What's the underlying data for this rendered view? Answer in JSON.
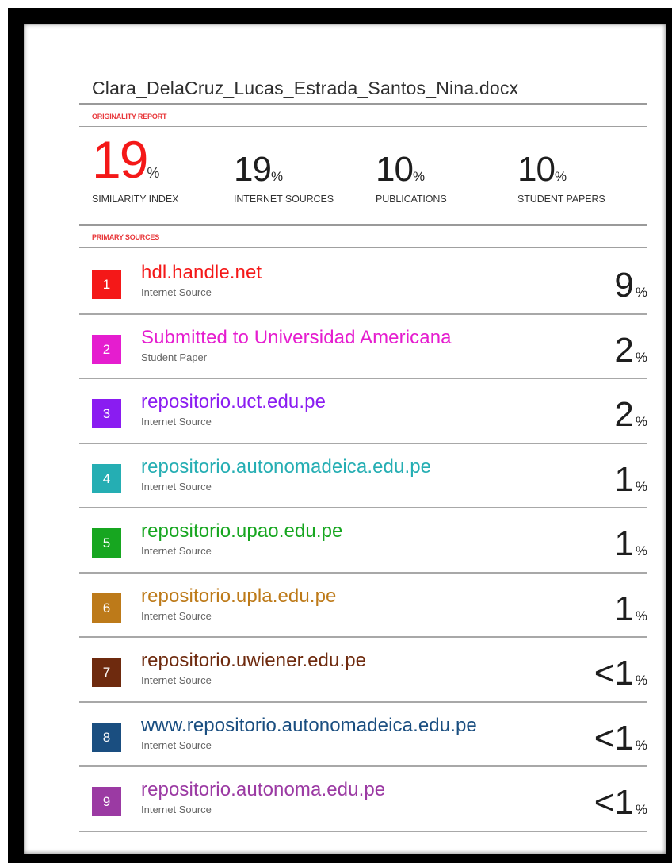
{
  "document": {
    "title": "Clara_DelaCruz_Lucas_Estrada_Santos_Nina.docx"
  },
  "originality_report": {
    "label": "ORIGINALITY REPORT",
    "similarity_index": {
      "value": "19",
      "unit": "%",
      "label": "SIMILARITY INDEX"
    },
    "internet_sources": {
      "value": "19",
      "unit": "%",
      "label": "INTERNET SOURCES"
    },
    "publications": {
      "value": "10",
      "unit": "%",
      "label": "PUBLICATIONS"
    },
    "student_papers": {
      "value": "10",
      "unit": "%",
      "label": "STUDENT PAPERS"
    }
  },
  "primary_sources": {
    "label": "PRIMARY SOURCES",
    "items": [
      {
        "rank": "1",
        "name": "hdl.handle.net",
        "type": "Internet Source",
        "percent": "9",
        "unit": "%",
        "color": "#f41818"
      },
      {
        "rank": "2",
        "name": "Submitted to Universidad Americana",
        "type": "Student Paper",
        "percent": "2",
        "unit": "%",
        "color": "#e51dcf"
      },
      {
        "rank": "3",
        "name": "repositorio.uct.edu.pe",
        "type": "Internet Source",
        "percent": "2",
        "unit": "%",
        "color": "#8a1cf1"
      },
      {
        "rank": "4",
        "name": "repositorio.autonomadeica.edu.pe",
        "type": "Internet Source",
        "percent": "1",
        "unit": "%",
        "color": "#25aeb3"
      },
      {
        "rank": "5",
        "name": "repositorio.upao.edu.pe",
        "type": "Internet Source",
        "percent": "1",
        "unit": "%",
        "color": "#17a620"
      },
      {
        "rank": "6",
        "name": "repositorio.upla.edu.pe",
        "type": "Internet Source",
        "percent": "1",
        "unit": "%",
        "color": "#bd7a19"
      },
      {
        "rank": "7",
        "name": "repositorio.uwiener.edu.pe",
        "type": "Internet Source",
        "percent": "<1",
        "unit": "%",
        "color": "#6e2a0e"
      },
      {
        "rank": "8",
        "name": "www.repositorio.autonomadeica.edu.pe",
        "type": "Internet Source",
        "percent": "<1",
        "unit": "%",
        "color": "#1a4e80"
      },
      {
        "rank": "9",
        "name": "repositorio.autonoma.edu.pe",
        "type": "Internet Source",
        "percent": "<1",
        "unit": "%",
        "color": "#9b3aa3"
      }
    ]
  }
}
